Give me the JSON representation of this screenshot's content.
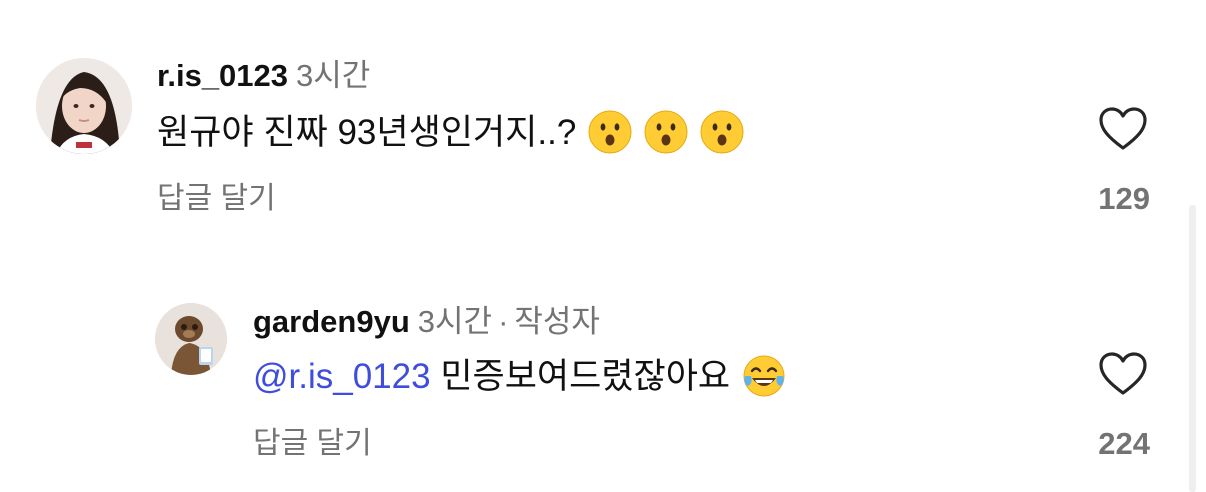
{
  "comments": [
    {
      "username": "r.is_0123",
      "time": "3시간",
      "text": "원규야 진짜 93년생인거지..?",
      "emojis": [
        "hushed-face-emoji",
        "hushed-face-emoji",
        "hushed-face-emoji"
      ],
      "reply_label": "답글 달기",
      "likes": "129"
    },
    {
      "username": "garden9yu",
      "time": "3시간",
      "separator": "·",
      "author_badge": "작성자",
      "mention": "@r.is_0123",
      "text": "민증보여드렸잖아요",
      "emojis": [
        "tears-of-joy-emoji"
      ],
      "reply_label": "답글 달기",
      "likes": "224"
    }
  ]
}
